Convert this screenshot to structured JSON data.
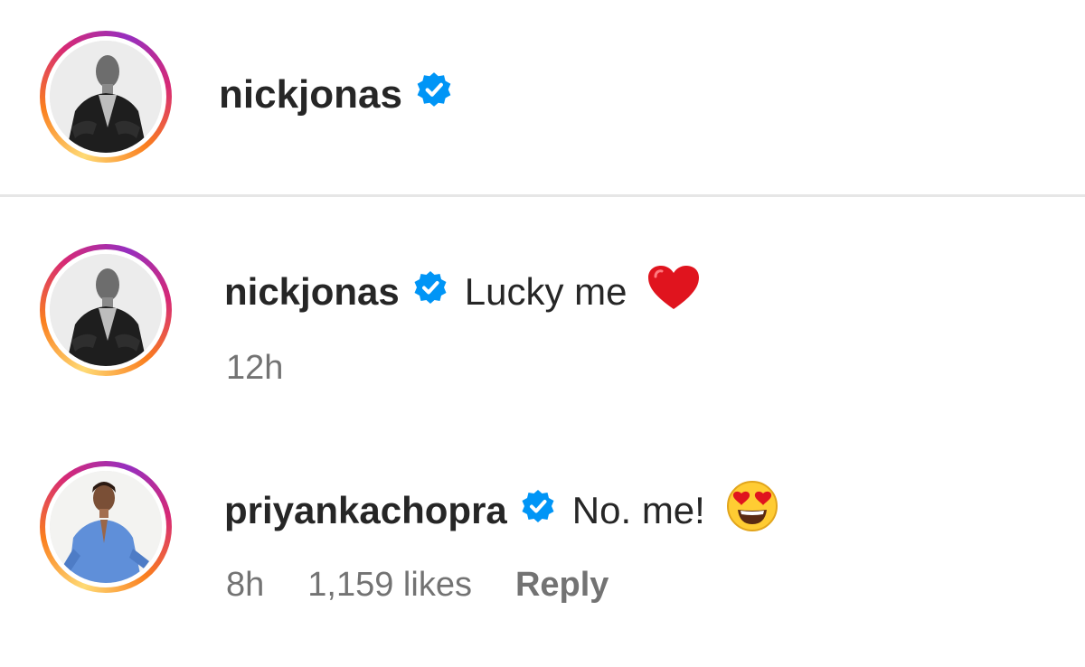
{
  "header": {
    "username": "nickjonas",
    "avatar_icon": "nickjonas-avatar",
    "verified_icon": "verified-badge-icon"
  },
  "comments": [
    {
      "username": "nickjonas",
      "text": "Lucky me",
      "emoji": "red-heart-icon",
      "time": "12h"
    },
    {
      "username": "priyankachopra",
      "text": "No. me!",
      "emoji": "heart-eyes-face-icon",
      "time": "8h",
      "likes": "1,159 likes",
      "reply_label": "Reply"
    }
  ],
  "colors": {
    "verified_blue": "#0095f6",
    "secondary_text": "#737373",
    "primary_text": "#262626"
  }
}
